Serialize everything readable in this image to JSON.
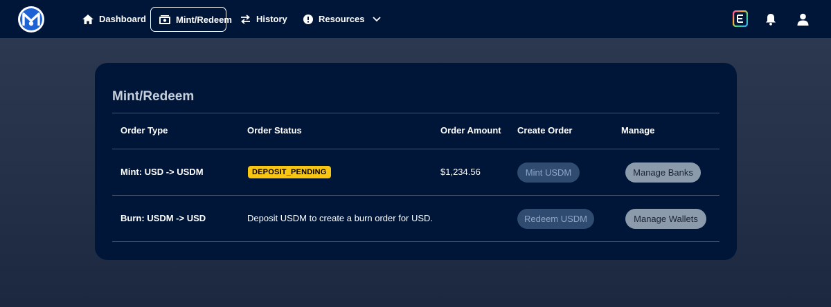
{
  "nav": {
    "items": [
      {
        "label": "Dashboard",
        "icon": "home-icon"
      },
      {
        "label": "Mint/Redeem",
        "icon": "money-icon",
        "active": true
      },
      {
        "label": "History",
        "icon": "swap-arrows-icon"
      },
      {
        "label": "Resources",
        "icon": "alert-circle-icon"
      }
    ]
  },
  "card": {
    "title": "Mint/Redeem",
    "columns": [
      "Order Type",
      "Order Status",
      "Order Amount",
      "Create Order",
      "Manage"
    ],
    "rows": [
      {
        "order_type": "Mint: USD -> USDM",
        "status_badge": "DEPOSIT_PENDING",
        "amount": "$1,234.56",
        "create_label": "Mint USDM",
        "manage_label": "Manage Banks"
      },
      {
        "order_type": "Burn: USDM -> USD",
        "status_text": "Deposit USDM to create a burn order for USD.",
        "amount": "",
        "create_label": "Redeem USDM",
        "manage_label": "Manage Wallets"
      }
    ]
  },
  "colors": {
    "nav_bg": "#001638",
    "card_bg": "#001638",
    "badge": "#f9c513",
    "primary_button": "#2f4b70",
    "secondary_button": "#8b9bab"
  }
}
